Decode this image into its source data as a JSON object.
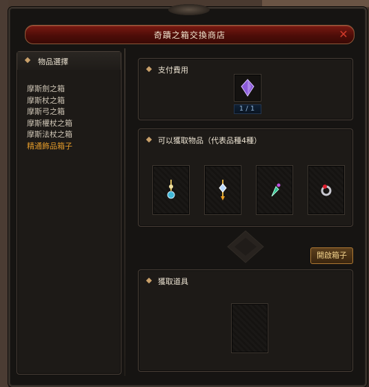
{
  "window": {
    "title": "奇蹟之箱交換商店",
    "close_icon": "close-x-icon"
  },
  "left_panel": {
    "heading": "物品選擇",
    "items": [
      {
        "label": "摩斯劍之箱",
        "selected": false
      },
      {
        "label": "摩斯杖之箱",
        "selected": false
      },
      {
        "label": "摩斯弓之箱",
        "selected": false
      },
      {
        "label": "摩斯權杖之箱",
        "selected": false
      },
      {
        "label": "摩斯法杖之箱",
        "selected": false
      },
      {
        "label": "精通飾品箱子",
        "selected": true
      }
    ]
  },
  "payment": {
    "heading": "支付費用",
    "item_icon": "purple-gem-icon",
    "count": "1 / 1"
  },
  "obtainable": {
    "heading": "可以獲取物品（代表品種4種）",
    "items": [
      {
        "icon": "blue-pendant-icon"
      },
      {
        "icon": "gold-pendant-icon"
      },
      {
        "icon": "green-earring-icon"
      },
      {
        "icon": "red-ring-icon"
      }
    ]
  },
  "actions": {
    "open_box_label": "開啟箱子"
  },
  "result": {
    "heading": "獲取道具"
  },
  "colors": {
    "accent": "#e29a2a",
    "title_bar": "#5a1009",
    "panel_bg": "#1d1a17"
  }
}
